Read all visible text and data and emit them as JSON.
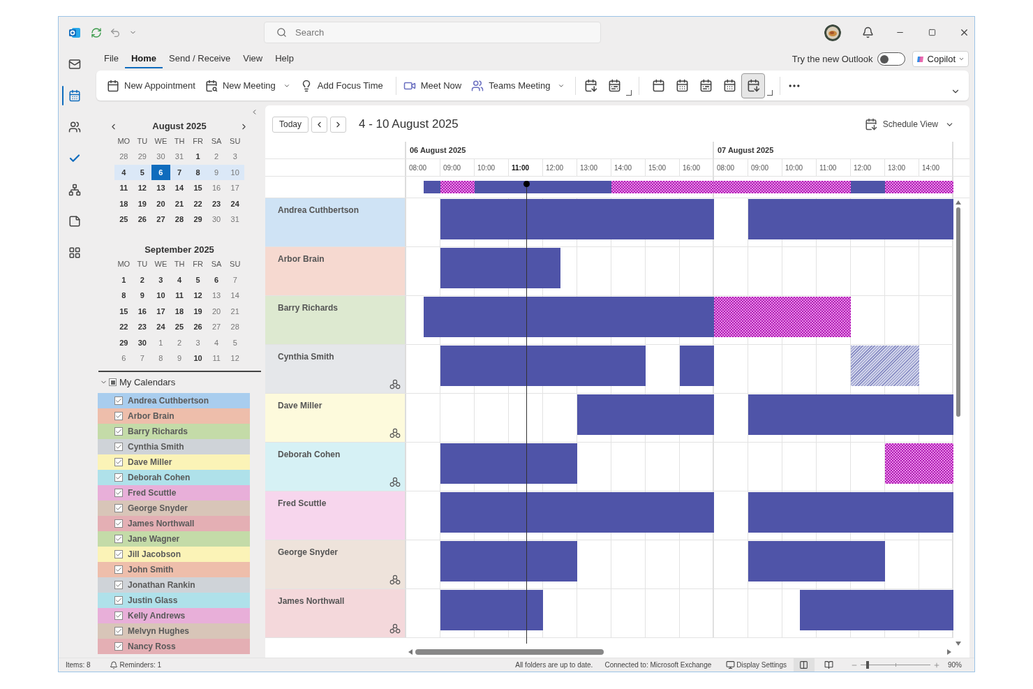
{
  "title_bar": {
    "search_placeholder": "Search"
  },
  "menu_tabs": [
    {
      "label": "File",
      "selected": false
    },
    {
      "label": "Home",
      "selected": true
    },
    {
      "label": "Send / Receive",
      "selected": false
    },
    {
      "label": "View",
      "selected": false
    },
    {
      "label": "Help",
      "selected": false
    }
  ],
  "new_outlook": {
    "label": "Try the new Outlook",
    "on": false
  },
  "copilot": {
    "label": "Copilot"
  },
  "ribbon": {
    "groups": [
      [
        {
          "label": "New Appointment",
          "dropdown": false
        },
        {
          "label": "New Meeting",
          "dropdown": true
        },
        {
          "label": "Add Focus Time",
          "dropdown": false
        }
      ],
      [
        {
          "label": "Meet Now",
          "dropdown": false
        },
        {
          "label": "Teams Meeting",
          "dropdown": true
        }
      ]
    ],
    "arrange_buttons": [
      {
        "selected": false
      },
      {
        "selected": false
      },
      {
        "selected": false
      },
      {
        "selected": false
      },
      {
        "selected": true
      }
    ]
  },
  "mini_calendars": [
    {
      "title": "August 2025",
      "weekdays": [
        "MO",
        "TU",
        "WE",
        "TH",
        "FR",
        "SA",
        "SU"
      ],
      "weeks": [
        {
          "selected": false,
          "days": [
            {
              "t": "28",
              "bold": false,
              "selected": false
            },
            {
              "t": "29",
              "bold": false,
              "selected": false
            },
            {
              "t": "30",
              "bold": false,
              "selected": false
            },
            {
              "t": "31",
              "bold": false,
              "selected": false
            },
            {
              "t": "1",
              "bold": true,
              "selected": false
            },
            {
              "t": "2",
              "bold": false,
              "selected": false
            },
            {
              "t": "3",
              "bold": false,
              "selected": false
            }
          ]
        },
        {
          "selected": true,
          "days": [
            {
              "t": "4",
              "bold": true,
              "selected": false
            },
            {
              "t": "5",
              "bold": true,
              "selected": false
            },
            {
              "t": "6",
              "bold": true,
              "selected": true
            },
            {
              "t": "7",
              "bold": true,
              "selected": false
            },
            {
              "t": "8",
              "bold": true,
              "selected": false
            },
            {
              "t": "9",
              "bold": false,
              "selected": false
            },
            {
              "t": "10",
              "bold": false,
              "selected": false
            }
          ]
        },
        {
          "selected": false,
          "days": [
            {
              "t": "11",
              "bold": true,
              "selected": false
            },
            {
              "t": "12",
              "bold": true,
              "selected": false
            },
            {
              "t": "13",
              "bold": true,
              "selected": false
            },
            {
              "t": "14",
              "bold": true,
              "selected": false
            },
            {
              "t": "15",
              "bold": true,
              "selected": false
            },
            {
              "t": "16",
              "bold": false,
              "selected": false
            },
            {
              "t": "17",
              "bold": false,
              "selected": false
            }
          ]
        },
        {
          "selected": false,
          "days": [
            {
              "t": "18",
              "bold": true,
              "selected": false
            },
            {
              "t": "19",
              "bold": true,
              "selected": false
            },
            {
              "t": "20",
              "bold": true,
              "selected": false
            },
            {
              "t": "21",
              "bold": true,
              "selected": false
            },
            {
              "t": "22",
              "bold": true,
              "selected": false
            },
            {
              "t": "23",
              "bold": true,
              "selected": false
            },
            {
              "t": "24",
              "bold": true,
              "selected": false
            }
          ]
        },
        {
          "selected": false,
          "days": [
            {
              "t": "25",
              "bold": true,
              "selected": false
            },
            {
              "t": "26",
              "bold": true,
              "selected": false
            },
            {
              "t": "27",
              "bold": true,
              "selected": false
            },
            {
              "t": "28",
              "bold": true,
              "selected": false
            },
            {
              "t": "29",
              "bold": true,
              "selected": false
            },
            {
              "t": "30",
              "bold": false,
              "selected": false
            },
            {
              "t": "31",
              "bold": false,
              "selected": false
            }
          ]
        }
      ]
    },
    {
      "title": "September 2025",
      "weekdays": [
        "MO",
        "TU",
        "WE",
        "TH",
        "FR",
        "SA",
        "SU"
      ],
      "weeks": [
        {
          "selected": false,
          "days": [
            {
              "t": "1",
              "bold": true,
              "selected": false
            },
            {
              "t": "2",
              "bold": true,
              "selected": false
            },
            {
              "t": "3",
              "bold": true,
              "selected": false
            },
            {
              "t": "4",
              "bold": true,
              "selected": false
            },
            {
              "t": "5",
              "bold": true,
              "selected": false
            },
            {
              "t": "6",
              "bold": true,
              "selected": false
            },
            {
              "t": "7",
              "bold": false,
              "selected": false
            }
          ]
        },
        {
          "selected": false,
          "days": [
            {
              "t": "8",
              "bold": true,
              "selected": false
            },
            {
              "t": "9",
              "bold": true,
              "selected": false
            },
            {
              "t": "10",
              "bold": true,
              "selected": false
            },
            {
              "t": "11",
              "bold": true,
              "selected": false
            },
            {
              "t": "12",
              "bold": true,
              "selected": false
            },
            {
              "t": "13",
              "bold": false,
              "selected": false
            },
            {
              "t": "14",
              "bold": false,
              "selected": false
            }
          ]
        },
        {
          "selected": false,
          "days": [
            {
              "t": "15",
              "bold": true,
              "selected": false
            },
            {
              "t": "16",
              "bold": true,
              "selected": false
            },
            {
              "t": "17",
              "bold": true,
              "selected": false
            },
            {
              "t": "18",
              "bold": true,
              "selected": false
            },
            {
              "t": "19",
              "bold": true,
              "selected": false
            },
            {
              "t": "20",
              "bold": false,
              "selected": false
            },
            {
              "t": "21",
              "bold": false,
              "selected": false
            }
          ]
        },
        {
          "selected": false,
          "days": [
            {
              "t": "22",
              "bold": true,
              "selected": false
            },
            {
              "t": "23",
              "bold": true,
              "selected": false
            },
            {
              "t": "24",
              "bold": true,
              "selected": false
            },
            {
              "t": "25",
              "bold": true,
              "selected": false
            },
            {
              "t": "26",
              "bold": true,
              "selected": false
            },
            {
              "t": "27",
              "bold": false,
              "selected": false
            },
            {
              "t": "28",
              "bold": false,
              "selected": false
            }
          ]
        },
        {
          "selected": false,
          "days": [
            {
              "t": "29",
              "bold": true,
              "selected": false
            },
            {
              "t": "30",
              "bold": true,
              "selected": false
            },
            {
              "t": "1",
              "bold": false,
              "selected": false
            },
            {
              "t": "2",
              "bold": false,
              "selected": false
            },
            {
              "t": "3",
              "bold": false,
              "selected": false
            },
            {
              "t": "4",
              "bold": false,
              "selected": false
            },
            {
              "t": "5",
              "bold": false,
              "selected": false
            }
          ]
        },
        {
          "selected": false,
          "days": [
            {
              "t": "6",
              "bold": false,
              "selected": false
            },
            {
              "t": "7",
              "bold": false,
              "selected": false
            },
            {
              "t": "8",
              "bold": false,
              "selected": false
            },
            {
              "t": "9",
              "bold": false,
              "selected": false
            },
            {
              "t": "10",
              "bold": true,
              "selected": false
            },
            {
              "t": "11",
              "bold": false,
              "selected": false
            },
            {
              "t": "12",
              "bold": false,
              "selected": false
            }
          ]
        }
      ]
    }
  ],
  "calendars": {
    "title": "My Calendars",
    "expanded": true,
    "partial": true,
    "items": [
      {
        "name": "Andrea Cuthbertson",
        "checked": true,
        "color": "#a9cdee"
      },
      {
        "name": "Arbor Brain",
        "checked": true,
        "color": "#eebeab"
      },
      {
        "name": "Barry Richards",
        "checked": true,
        "color": "#c4dba8"
      },
      {
        "name": "Cynthia Smith",
        "checked": true,
        "color": "#cfd3d8"
      },
      {
        "name": "Dave Miller",
        "checked": true,
        "color": "#fbf3b7"
      },
      {
        "name": "Deborah Cohen",
        "checked": true,
        "color": "#afe1ea"
      },
      {
        "name": "Fred Scuttle",
        "checked": true,
        "color": "#e8afd9"
      },
      {
        "name": "George Snyder",
        "checked": true,
        "color": "#d8c5b8"
      },
      {
        "name": "James Northwall",
        "checked": true,
        "color": "#e4afb4"
      },
      {
        "name": "Jane Wagner",
        "checked": true,
        "color": "#c4dba8"
      },
      {
        "name": "Jill Jacobson",
        "checked": true,
        "color": "#fbf3b7"
      },
      {
        "name": "John Smith",
        "checked": true,
        "color": "#eebeab"
      },
      {
        "name": "Jonathan Rankin",
        "checked": true,
        "color": "#cfd3d8"
      },
      {
        "name": "Justin Glass",
        "checked": true,
        "color": "#afe1ea"
      },
      {
        "name": "Kelly Andrews",
        "checked": true,
        "color": "#e8afd9"
      },
      {
        "name": "Melvyn Hughes",
        "checked": true,
        "color": "#d8c5b8"
      },
      {
        "name": "Nancy Ross",
        "checked": true,
        "color": "#e4afb4"
      }
    ]
  },
  "schedule": {
    "today": "Today",
    "range": "4 - 10 August 2025",
    "view": "Schedule View",
    "days": [
      {
        "title": "06 August 2025",
        "hours": [
          {
            "t": "08:00",
            "current": false
          },
          {
            "t": "09:00",
            "current": false
          },
          {
            "t": "10:00",
            "current": false
          },
          {
            "t": "11:00",
            "current": true
          },
          {
            "t": "12:00",
            "current": false
          },
          {
            "t": "13:00",
            "current": false
          },
          {
            "t": "14:00",
            "current": false
          },
          {
            "t": "15:00",
            "current": false
          },
          {
            "t": "16:00",
            "current": false
          }
        ]
      },
      {
        "title": "07 August 2025",
        "hours": [
          {
            "t": "08:00",
            "current": false
          },
          {
            "t": "09:00",
            "current": false
          },
          {
            "t": "10:00",
            "current": false
          },
          {
            "t": "11:00",
            "current": false
          },
          {
            "t": "12:00",
            "current": false
          },
          {
            "t": "13:00",
            "current": false
          },
          {
            "t": "14:00",
            "current": false
          }
        ]
      }
    ],
    "summary": [
      {
        "slots": [
          {
            "kind": "free"
          },
          {
            "kind": "busy"
          },
          {
            "kind": "oof"
          },
          {
            "kind": "oof"
          },
          {
            "kind": "busy"
          },
          {
            "kind": "busy"
          },
          {
            "kind": "busy"
          },
          {
            "kind": "busy"
          },
          {
            "kind": "busy"
          },
          {
            "kind": "busy"
          },
          {
            "kind": "busy"
          },
          {
            "kind": "busy"
          },
          {
            "kind": "oof"
          },
          {
            "kind": "oof"
          },
          {
            "kind": "oof"
          },
          {
            "kind": "oof"
          },
          {
            "kind": "oof"
          },
          {
            "kind": "oof"
          }
        ]
      },
      {
        "slots": [
          {
            "kind": "oof"
          },
          {
            "kind": "oof"
          },
          {
            "kind": "oof"
          },
          {
            "kind": "oof"
          },
          {
            "kind": "oof"
          },
          {
            "kind": "oof"
          },
          {
            "kind": "oof"
          },
          {
            "kind": "oof"
          },
          {
            "kind": "busy"
          },
          {
            "kind": "busy"
          },
          {
            "kind": "oof"
          },
          {
            "kind": "oof"
          },
          {
            "kind": "oof"
          },
          {
            "kind": "oof"
          }
        ]
      }
    ],
    "rows": [
      {
        "name": "Andrea Cuthbertson",
        "color": "#cfe3f5",
        "group_icon": false,
        "days": [
          {
            "slots": [
              {
                "kind": "free"
              },
              {
                "kind": "free"
              },
              {
                "kind": "busy"
              },
              {
                "kind": "busy"
              },
              {
                "kind": "busy"
              },
              {
                "kind": "busy"
              },
              {
                "kind": "busy"
              },
              {
                "kind": "busy"
              },
              {
                "kind": "busy"
              },
              {
                "kind": "busy"
              },
              {
                "kind": "busy"
              },
              {
                "kind": "busy"
              },
              {
                "kind": "busy"
              },
              {
                "kind": "busy"
              },
              {
                "kind": "busy"
              },
              {
                "kind": "busy"
              },
              {
                "kind": "busy"
              },
              {
                "kind": "busy"
              }
            ]
          },
          {
            "slots": [
              {
                "kind": "free"
              },
              {
                "kind": "free"
              },
              {
                "kind": "busy"
              },
              {
                "kind": "busy"
              },
              {
                "kind": "busy"
              },
              {
                "kind": "busy"
              },
              {
                "kind": "busy"
              },
              {
                "kind": "busy"
              },
              {
                "kind": "busy"
              },
              {
                "kind": "busy"
              },
              {
                "kind": "busy"
              },
              {
                "kind": "busy"
              },
              {
                "kind": "busy"
              },
              {
                "kind": "busy"
              }
            ]
          }
        ]
      },
      {
        "name": "Arbor Brain",
        "color": "#f6d9d0",
        "group_icon": false,
        "days": [
          {
            "slots": [
              {
                "kind": "free"
              },
              {
                "kind": "free"
              },
              {
                "kind": "busy"
              },
              {
                "kind": "busy"
              },
              {
                "kind": "busy"
              },
              {
                "kind": "busy"
              },
              {
                "kind": "busy"
              },
              {
                "kind": "busy"
              },
              {
                "kind": "busy"
              },
              {
                "kind": "free"
              },
              {
                "kind": "free"
              },
              {
                "kind": "free"
              },
              {
                "kind": "free"
              },
              {
                "kind": "free"
              },
              {
                "kind": "free"
              },
              {
                "kind": "free"
              },
              {
                "kind": "free"
              },
              {
                "kind": "free"
              }
            ]
          },
          {
            "slots": [
              {
                "kind": "free"
              },
              {
                "kind": "free"
              },
              {
                "kind": "free"
              },
              {
                "kind": "free"
              },
              {
                "kind": "free"
              },
              {
                "kind": "free"
              },
              {
                "kind": "free"
              },
              {
                "kind": "free"
              },
              {
                "kind": "free"
              },
              {
                "kind": "free"
              },
              {
                "kind": "free"
              },
              {
                "kind": "free"
              },
              {
                "kind": "free"
              },
              {
                "kind": "free"
              }
            ]
          }
        ]
      },
      {
        "name": "Barry Richards",
        "color": "#dde9d0",
        "group_icon": false,
        "days": [
          {
            "slots": [
              {
                "kind": "free"
              },
              {
                "kind": "busy"
              },
              {
                "kind": "busy"
              },
              {
                "kind": "busy"
              },
              {
                "kind": "busy"
              },
              {
                "kind": "busy"
              },
              {
                "kind": "busy"
              },
              {
                "kind": "busy"
              },
              {
                "kind": "busy"
              },
              {
                "kind": "busy"
              },
              {
                "kind": "busy"
              },
              {
                "kind": "busy"
              },
              {
                "kind": "busy"
              },
              {
                "kind": "busy"
              },
              {
                "kind": "busy"
              },
              {
                "kind": "busy"
              },
              {
                "kind": "busy"
              },
              {
                "kind": "busy"
              }
            ]
          },
          {
            "slots": [
              {
                "kind": "oof"
              },
              {
                "kind": "oof"
              },
              {
                "kind": "oof"
              },
              {
                "kind": "oof"
              },
              {
                "kind": "oof"
              },
              {
                "kind": "oof"
              },
              {
                "kind": "oof"
              },
              {
                "kind": "oof"
              },
              {
                "kind": "free"
              },
              {
                "kind": "free"
              },
              {
                "kind": "free"
              },
              {
                "kind": "free"
              },
              {
                "kind": "free"
              },
              {
                "kind": "free"
              }
            ]
          }
        ]
      },
      {
        "name": "Cynthia Smith",
        "color": "#e5e7ea",
        "group_icon": true,
        "days": [
          {
            "slots": [
              {
                "kind": "free"
              },
              {
                "kind": "free"
              },
              {
                "kind": "busy"
              },
              {
                "kind": "busy"
              },
              {
                "kind": "busy"
              },
              {
                "kind": "busy"
              },
              {
                "kind": "busy"
              },
              {
                "kind": "busy"
              },
              {
                "kind": "busy"
              },
              {
                "kind": "busy"
              },
              {
                "kind": "busy"
              },
              {
                "kind": "busy"
              },
              {
                "kind": "busy"
              },
              {
                "kind": "busy"
              },
              {
                "kind": "free"
              },
              {
                "kind": "free"
              },
              {
                "kind": "busy"
              },
              {
                "kind": "busy"
              }
            ]
          },
          {
            "slots": [
              {
                "kind": "free"
              },
              {
                "kind": "free"
              },
              {
                "kind": "free"
              },
              {
                "kind": "free"
              },
              {
                "kind": "free"
              },
              {
                "kind": "free"
              },
              {
                "kind": "free"
              },
              {
                "kind": "free"
              },
              {
                "kind": "tentative"
              },
              {
                "kind": "tentative"
              },
              {
                "kind": "tentative"
              },
              {
                "kind": "tentative"
              },
              {
                "kind": "free"
              },
              {
                "kind": "free"
              }
            ]
          }
        ]
      },
      {
        "name": "Dave Miller",
        "color": "#fdfadc",
        "group_icon": true,
        "days": [
          {
            "slots": [
              {
                "kind": "free"
              },
              {
                "kind": "free"
              },
              {
                "kind": "free"
              },
              {
                "kind": "free"
              },
              {
                "kind": "free"
              },
              {
                "kind": "free"
              },
              {
                "kind": "free"
              },
              {
                "kind": "free"
              },
              {
                "kind": "free"
              },
              {
                "kind": "free"
              },
              {
                "kind": "busy"
              },
              {
                "kind": "busy"
              },
              {
                "kind": "busy"
              },
              {
                "kind": "busy"
              },
              {
                "kind": "busy"
              },
              {
                "kind": "busy"
              },
              {
                "kind": "busy"
              },
              {
                "kind": "busy"
              }
            ]
          },
          {
            "slots": [
              {
                "kind": "free"
              },
              {
                "kind": "free"
              },
              {
                "kind": "busy"
              },
              {
                "kind": "busy"
              },
              {
                "kind": "busy"
              },
              {
                "kind": "busy"
              },
              {
                "kind": "busy"
              },
              {
                "kind": "busy"
              },
              {
                "kind": "busy"
              },
              {
                "kind": "busy"
              },
              {
                "kind": "busy"
              },
              {
                "kind": "busy"
              },
              {
                "kind": "busy"
              },
              {
                "kind": "busy"
              }
            ]
          }
        ]
      },
      {
        "name": "Deborah Cohen",
        "color": "#d6f1f5",
        "group_icon": true,
        "days": [
          {
            "slots": [
              {
                "kind": "free"
              },
              {
                "kind": "free"
              },
              {
                "kind": "busy"
              },
              {
                "kind": "busy"
              },
              {
                "kind": "busy"
              },
              {
                "kind": "busy"
              },
              {
                "kind": "busy"
              },
              {
                "kind": "busy"
              },
              {
                "kind": "busy"
              },
              {
                "kind": "busy"
              },
              {
                "kind": "free"
              },
              {
                "kind": "free"
              },
              {
                "kind": "free"
              },
              {
                "kind": "free"
              },
              {
                "kind": "free"
              },
              {
                "kind": "free"
              },
              {
                "kind": "free"
              },
              {
                "kind": "free"
              }
            ]
          },
          {
            "slots": [
              {
                "kind": "free"
              },
              {
                "kind": "free"
              },
              {
                "kind": "free"
              },
              {
                "kind": "free"
              },
              {
                "kind": "free"
              },
              {
                "kind": "free"
              },
              {
                "kind": "free"
              },
              {
                "kind": "free"
              },
              {
                "kind": "free"
              },
              {
                "kind": "free"
              },
              {
                "kind": "oof"
              },
              {
                "kind": "oof"
              },
              {
                "kind": "oof"
              },
              {
                "kind": "oof"
              }
            ]
          }
        ]
      },
      {
        "name": "Fred Scuttle",
        "color": "#f7d6ed",
        "group_icon": false,
        "days": [
          {
            "slots": [
              {
                "kind": "free"
              },
              {
                "kind": "free"
              },
              {
                "kind": "busy"
              },
              {
                "kind": "busy"
              },
              {
                "kind": "busy"
              },
              {
                "kind": "busy"
              },
              {
                "kind": "busy"
              },
              {
                "kind": "busy"
              },
              {
                "kind": "busy"
              },
              {
                "kind": "busy"
              },
              {
                "kind": "busy"
              },
              {
                "kind": "busy"
              },
              {
                "kind": "busy"
              },
              {
                "kind": "busy"
              },
              {
                "kind": "busy"
              },
              {
                "kind": "busy"
              },
              {
                "kind": "busy"
              },
              {
                "kind": "busy"
              }
            ]
          },
          {
            "slots": [
              {
                "kind": "free"
              },
              {
                "kind": "free"
              },
              {
                "kind": "busy"
              },
              {
                "kind": "busy"
              },
              {
                "kind": "busy"
              },
              {
                "kind": "busy"
              },
              {
                "kind": "busy"
              },
              {
                "kind": "busy"
              },
              {
                "kind": "busy"
              },
              {
                "kind": "busy"
              },
              {
                "kind": "busy"
              },
              {
                "kind": "busy"
              },
              {
                "kind": "busy"
              },
              {
                "kind": "busy"
              }
            ]
          }
        ]
      },
      {
        "name": "George Snyder",
        "color": "#eee3db",
        "group_icon": true,
        "days": [
          {
            "slots": [
              {
                "kind": "free"
              },
              {
                "kind": "free"
              },
              {
                "kind": "busy"
              },
              {
                "kind": "busy"
              },
              {
                "kind": "busy"
              },
              {
                "kind": "busy"
              },
              {
                "kind": "busy"
              },
              {
                "kind": "busy"
              },
              {
                "kind": "busy"
              },
              {
                "kind": "busy"
              },
              {
                "kind": "free"
              },
              {
                "kind": "free"
              },
              {
                "kind": "free"
              },
              {
                "kind": "free"
              },
              {
                "kind": "free"
              },
              {
                "kind": "free"
              },
              {
                "kind": "free"
              },
              {
                "kind": "free"
              }
            ]
          },
          {
            "slots": [
              {
                "kind": "free"
              },
              {
                "kind": "free"
              },
              {
                "kind": "busy"
              },
              {
                "kind": "busy"
              },
              {
                "kind": "busy"
              },
              {
                "kind": "busy"
              },
              {
                "kind": "busy"
              },
              {
                "kind": "busy"
              },
              {
                "kind": "busy"
              },
              {
                "kind": "busy"
              },
              {
                "kind": "free"
              },
              {
                "kind": "free"
              },
              {
                "kind": "free"
              },
              {
                "kind": "free"
              }
            ]
          }
        ]
      },
      {
        "name": "James Northwall",
        "color": "#f4d8db",
        "group_icon": true,
        "days": [
          {
            "slots": [
              {
                "kind": "free"
              },
              {
                "kind": "free"
              },
              {
                "kind": "busy"
              },
              {
                "kind": "busy"
              },
              {
                "kind": "busy"
              },
              {
                "kind": "busy"
              },
              {
                "kind": "busy"
              },
              {
                "kind": "busy"
              },
              {
                "kind": "free"
              },
              {
                "kind": "free"
              },
              {
                "kind": "free"
              },
              {
                "kind": "free"
              },
              {
                "kind": "free"
              },
              {
                "kind": "free"
              },
              {
                "kind": "free"
              },
              {
                "kind": "free"
              },
              {
                "kind": "free"
              },
              {
                "kind": "free"
              }
            ]
          },
          {
            "slots": [
              {
                "kind": "free"
              },
              {
                "kind": "free"
              },
              {
                "kind": "free"
              },
              {
                "kind": "free"
              },
              {
                "kind": "free"
              },
              {
                "kind": "busy"
              },
              {
                "kind": "busy"
              },
              {
                "kind": "busy"
              },
              {
                "kind": "busy"
              },
              {
                "kind": "busy"
              },
              {
                "kind": "busy"
              },
              {
                "kind": "busy"
              },
              {
                "kind": "busy"
              },
              {
                "kind": "busy"
              }
            ]
          }
        ]
      }
    ]
  },
  "status_bar": {
    "items": "Items: 8",
    "reminders": "Reminders: 1",
    "sync": "All folders are up to date.",
    "connection": "Connected to: Microsoft Exchange",
    "display_settings": "Display Settings",
    "views": [
      {
        "selected": true
      },
      {
        "selected": false
      }
    ],
    "zoom": {
      "level": 0.1,
      "reading": "90%"
    }
  }
}
